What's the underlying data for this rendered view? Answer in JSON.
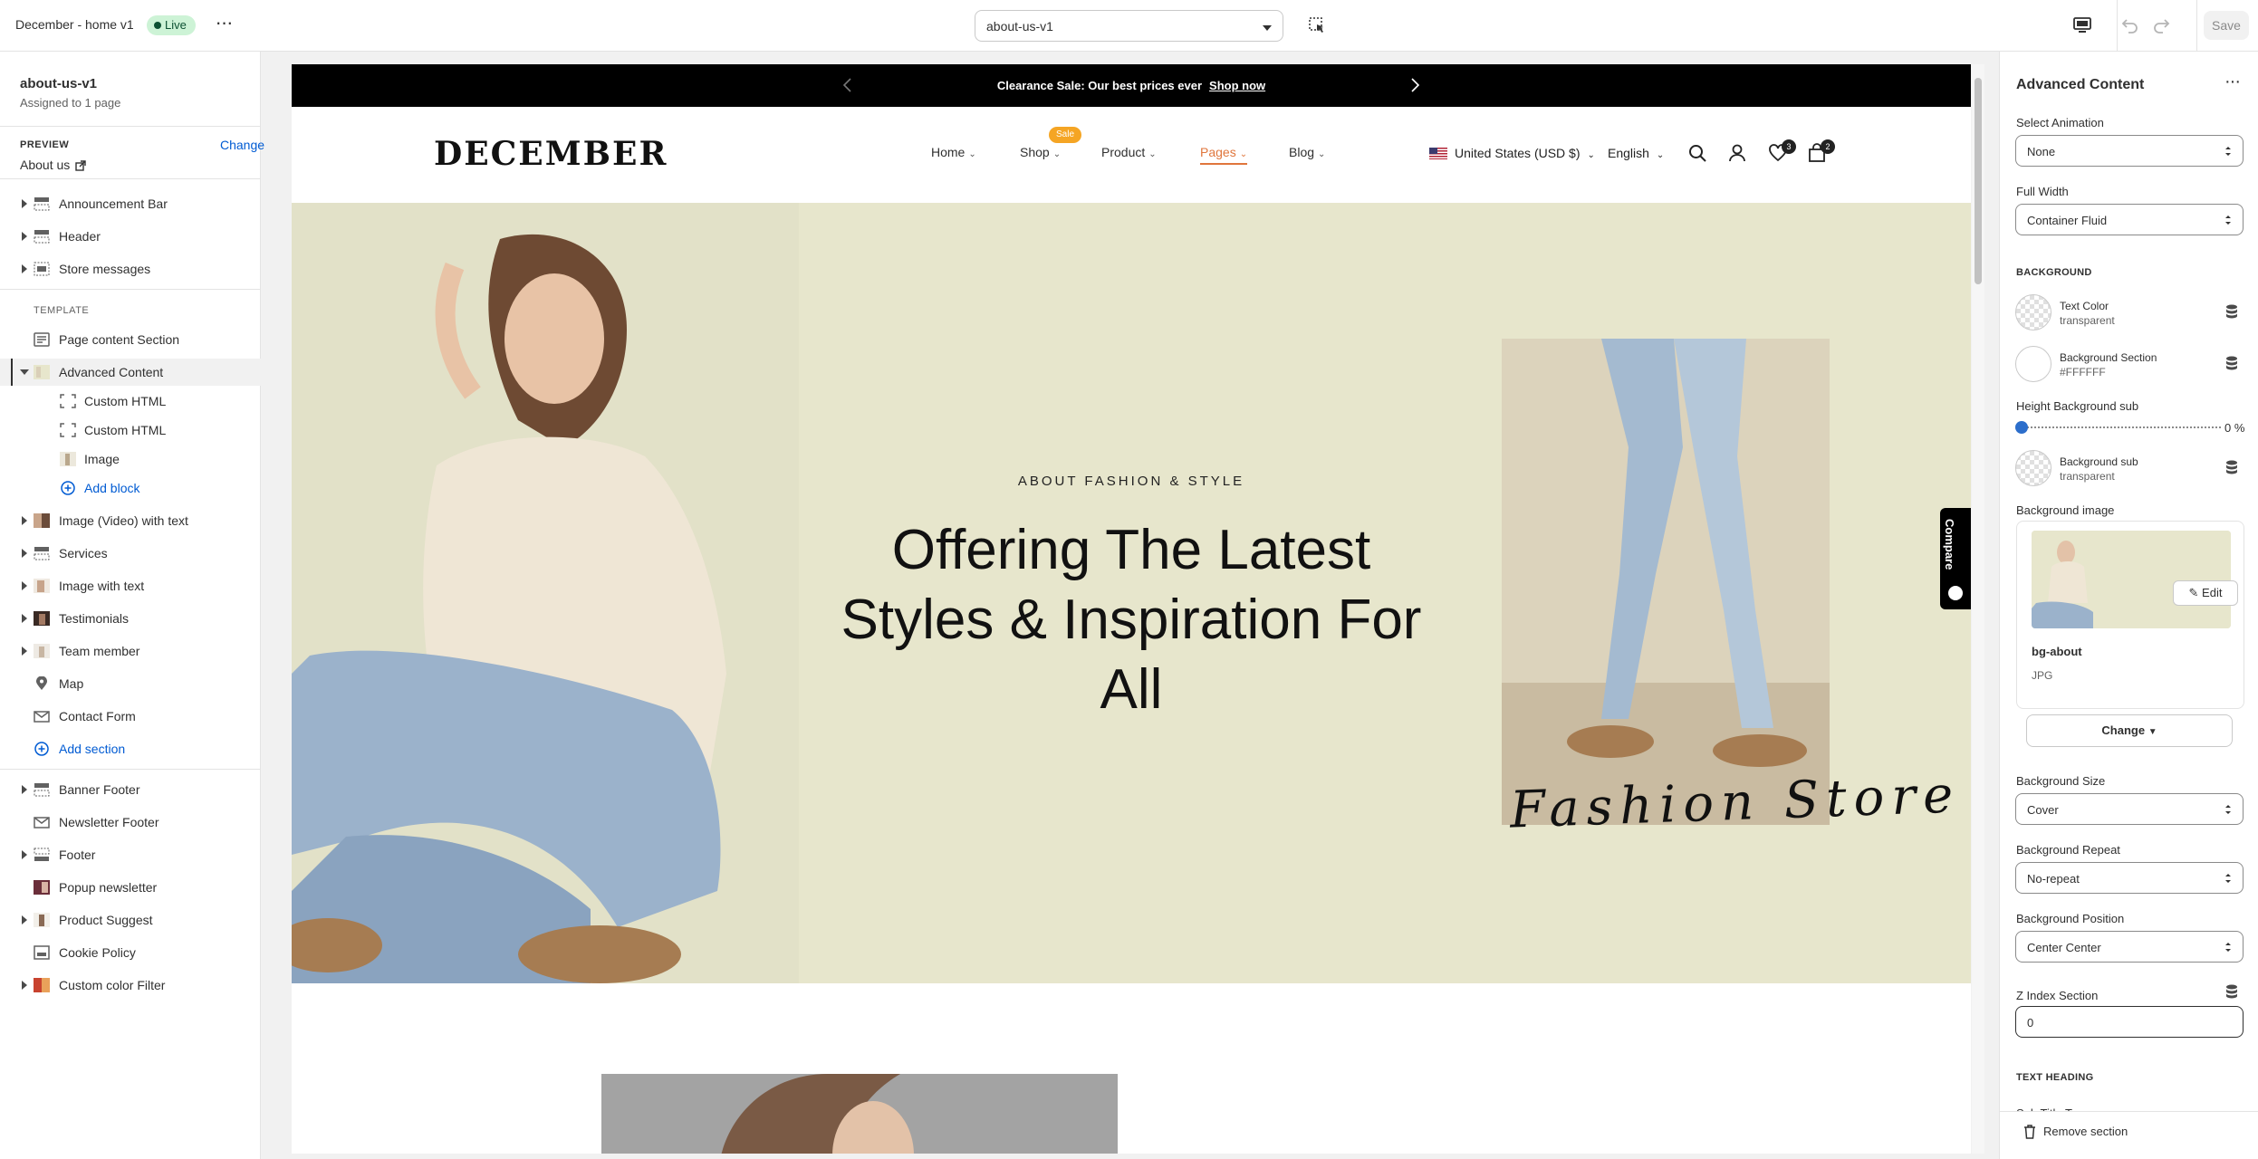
{
  "topbar": {
    "title": "December - home v1",
    "status": "Live",
    "page_select": "about-us-v1",
    "save_label": "Save"
  },
  "sidebar": {
    "template_name": "about-us-v1",
    "assigned": "Assigned to 1 page",
    "preview_label": "PREVIEW",
    "change_label": "Change",
    "preview_value": "About us",
    "header_group": [
      "Announcement Bar",
      "Header",
      "Store messages"
    ],
    "template_label": "TEMPLATE",
    "template_items": [
      "Page content Section",
      "Advanced Content"
    ],
    "blocks": [
      "Custom HTML",
      "Custom HTML",
      "Image"
    ],
    "add_block": "Add block",
    "sections": [
      "Image (Video) with text",
      "Services",
      "Image with text",
      "Testimonials",
      "Team member",
      "Map",
      "Contact Form"
    ],
    "add_section": "Add section",
    "footer_group": [
      "Banner Footer",
      "Newsletter Footer",
      "Footer",
      "Popup newsletter",
      "Product Suggest",
      "Cookie Policy",
      "Custom color Filter"
    ]
  },
  "preview": {
    "announcement": "Clearance Sale: Our best prices ever",
    "announcement_link": "Shop now",
    "logo": "DECEMBER",
    "nav": [
      "Home",
      "Shop",
      "Product",
      "Pages",
      "Blog"
    ],
    "sale_badge": "Sale",
    "currency": "United States (USD $)",
    "language": "English",
    "wishlist_count": "3",
    "cart_count": "2",
    "hero_subtitle": "ABOUT FASHION & STYLE",
    "hero_title": "Offering The Latest Styles & Inspiration For All",
    "script_text": "Fashion Store",
    "compare_label": "Compare"
  },
  "settings": {
    "title": "Advanced Content",
    "select_animation_label": "Select Animation",
    "select_animation": "None",
    "full_width_label": "Full Width",
    "full_width": "Container Fluid",
    "background_section": "BACKGROUND",
    "text_color_name": "Text Color",
    "text_color_value": "transparent",
    "bg_section_name": "Background Section",
    "bg_section_value": "#FFFFFF",
    "height_bg_sub_label": "Height Background sub",
    "height_bg_sub_value": "0 %",
    "bg_sub_name": "Background sub",
    "bg_sub_value": "transparent",
    "bg_image_label": "Background image",
    "edit_label": "Edit",
    "image_name": "bg-about",
    "image_type": "JPG",
    "change_label": "Change",
    "bg_size_label": "Background Size",
    "bg_size": "Cover",
    "bg_repeat_label": "Background Repeat",
    "bg_repeat": "No-repeat",
    "bg_position_label": "Background Position",
    "bg_position": "Center Center",
    "z_index_label": "Z Index Section",
    "z_index": "0",
    "text_heading_section": "TEXT HEADING",
    "sub_title_top_label": "Sub Title Top",
    "remove_section": "Remove section"
  },
  "colors": {
    "accent": "#005bd3",
    "hero_bg": "#e7e6cc",
    "nav_active": "#e0763c",
    "sale_badge": "#f5a524",
    "live_badge": "#cdf3d6"
  }
}
